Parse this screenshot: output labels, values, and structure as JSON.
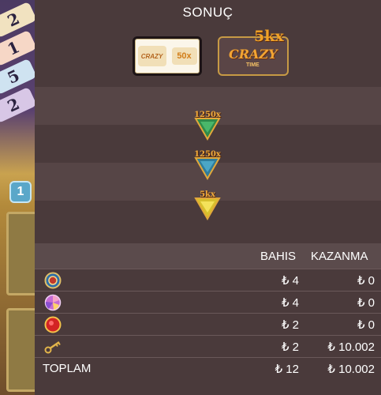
{
  "title": "SONUÇ",
  "top_slot": {
    "mini_logo_text": "CRAZY",
    "multiplier": "50x"
  },
  "bonus_game": {
    "logo_text": "CRAZY",
    "logo_sub": "TIME",
    "multiplier": "5kx"
  },
  "flappers": [
    {
      "label": "1250x",
      "color": "#2f8a4a"
    },
    {
      "label": "1250x",
      "color": "#2f7c9a"
    },
    {
      "label": "5kx",
      "color": "#d7c02c"
    }
  ],
  "table": {
    "headers": {
      "bet": "BAHIS",
      "win": "KAZANMA"
    },
    "rows": [
      {
        "icon": "coin-flip-icon",
        "bet": "₺ 4",
        "win": "₺ 0"
      },
      {
        "icon": "pachinko-icon",
        "bet": "₺ 4",
        "win": "₺ 0"
      },
      {
        "icon": "cash-hunt-icon",
        "bet": "₺ 2",
        "win": "₺ 0"
      },
      {
        "icon": "crazy-time-key-icon",
        "bet": "₺ 2",
        "win": "₺ 10.002"
      }
    ],
    "total": {
      "label": "TOPLAM",
      "bet": "₺ 12",
      "win": "₺ 10.002"
    }
  },
  "background": {
    "wheel_numbers": [
      "2",
      "1",
      "5",
      "2"
    ],
    "chip_value": "1"
  }
}
